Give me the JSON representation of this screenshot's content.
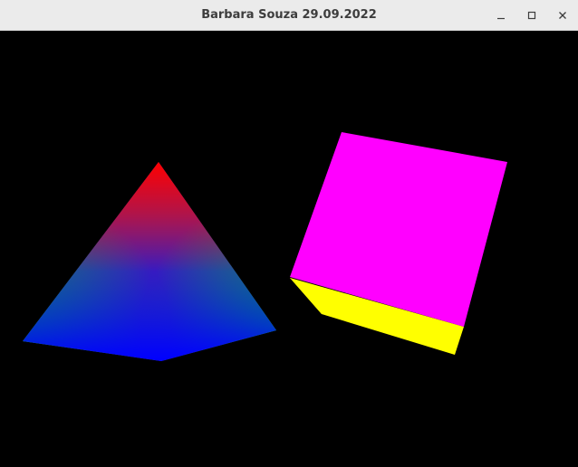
{
  "window": {
    "title": "Barbara Souza 29.09.2022",
    "controls": [
      {
        "name": "minimize",
        "icon": "minimize-icon"
      },
      {
        "name": "maximize",
        "icon": "maximize-icon"
      },
      {
        "name": "close",
        "icon": "close-icon"
      }
    ]
  },
  "scene": {
    "background": "#000000",
    "pyramid": {
      "vertex_colors": {
        "apex": "#ff0000",
        "left": "#00ff00",
        "right": "#00ff00",
        "bottom": "#0000ff"
      }
    },
    "cube": {
      "front_face_color": "#ff00ff",
      "bottom_face_color": "#ffff00"
    }
  }
}
